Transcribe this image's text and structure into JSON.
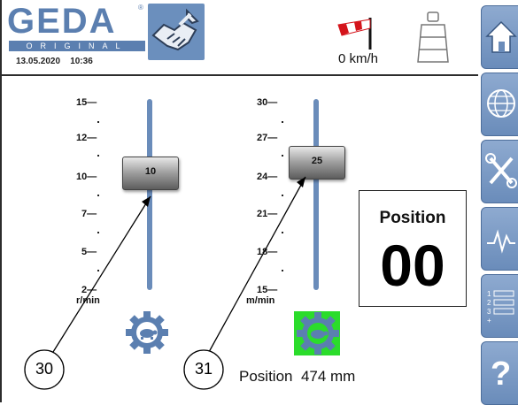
{
  "header": {
    "logo_text": "GEDA",
    "logo_mark": "®",
    "logo_sub": "ORIGINAL",
    "date": "13.05.2020",
    "time": "10:36",
    "wind_speed": "0 km/h"
  },
  "slider_left": {
    "ticks": [
      "15—",
      "12—",
      "10—",
      "7—",
      "5—",
      "2—"
    ],
    "unit": "r/min",
    "value": "10",
    "callout": "30"
  },
  "slider_right": {
    "ticks": [
      "30—",
      "27—",
      "24—",
      "21—",
      "18—",
      "15—"
    ],
    "unit": "m/min",
    "value": "25",
    "callout": "31"
  },
  "position": {
    "title": "Position",
    "value": "00",
    "readout_label": "Position",
    "readout_value": "474 mm"
  },
  "sidebar": {
    "items": [
      "home-icon",
      "globe-icon",
      "tools-icon",
      "diagnostics-icon",
      "list-icon",
      "help-icon"
    ]
  },
  "colors": {
    "brand_blue": "#5b7fb0",
    "button_blue": "#6a8cba",
    "active_green": "#2bdc2b"
  }
}
